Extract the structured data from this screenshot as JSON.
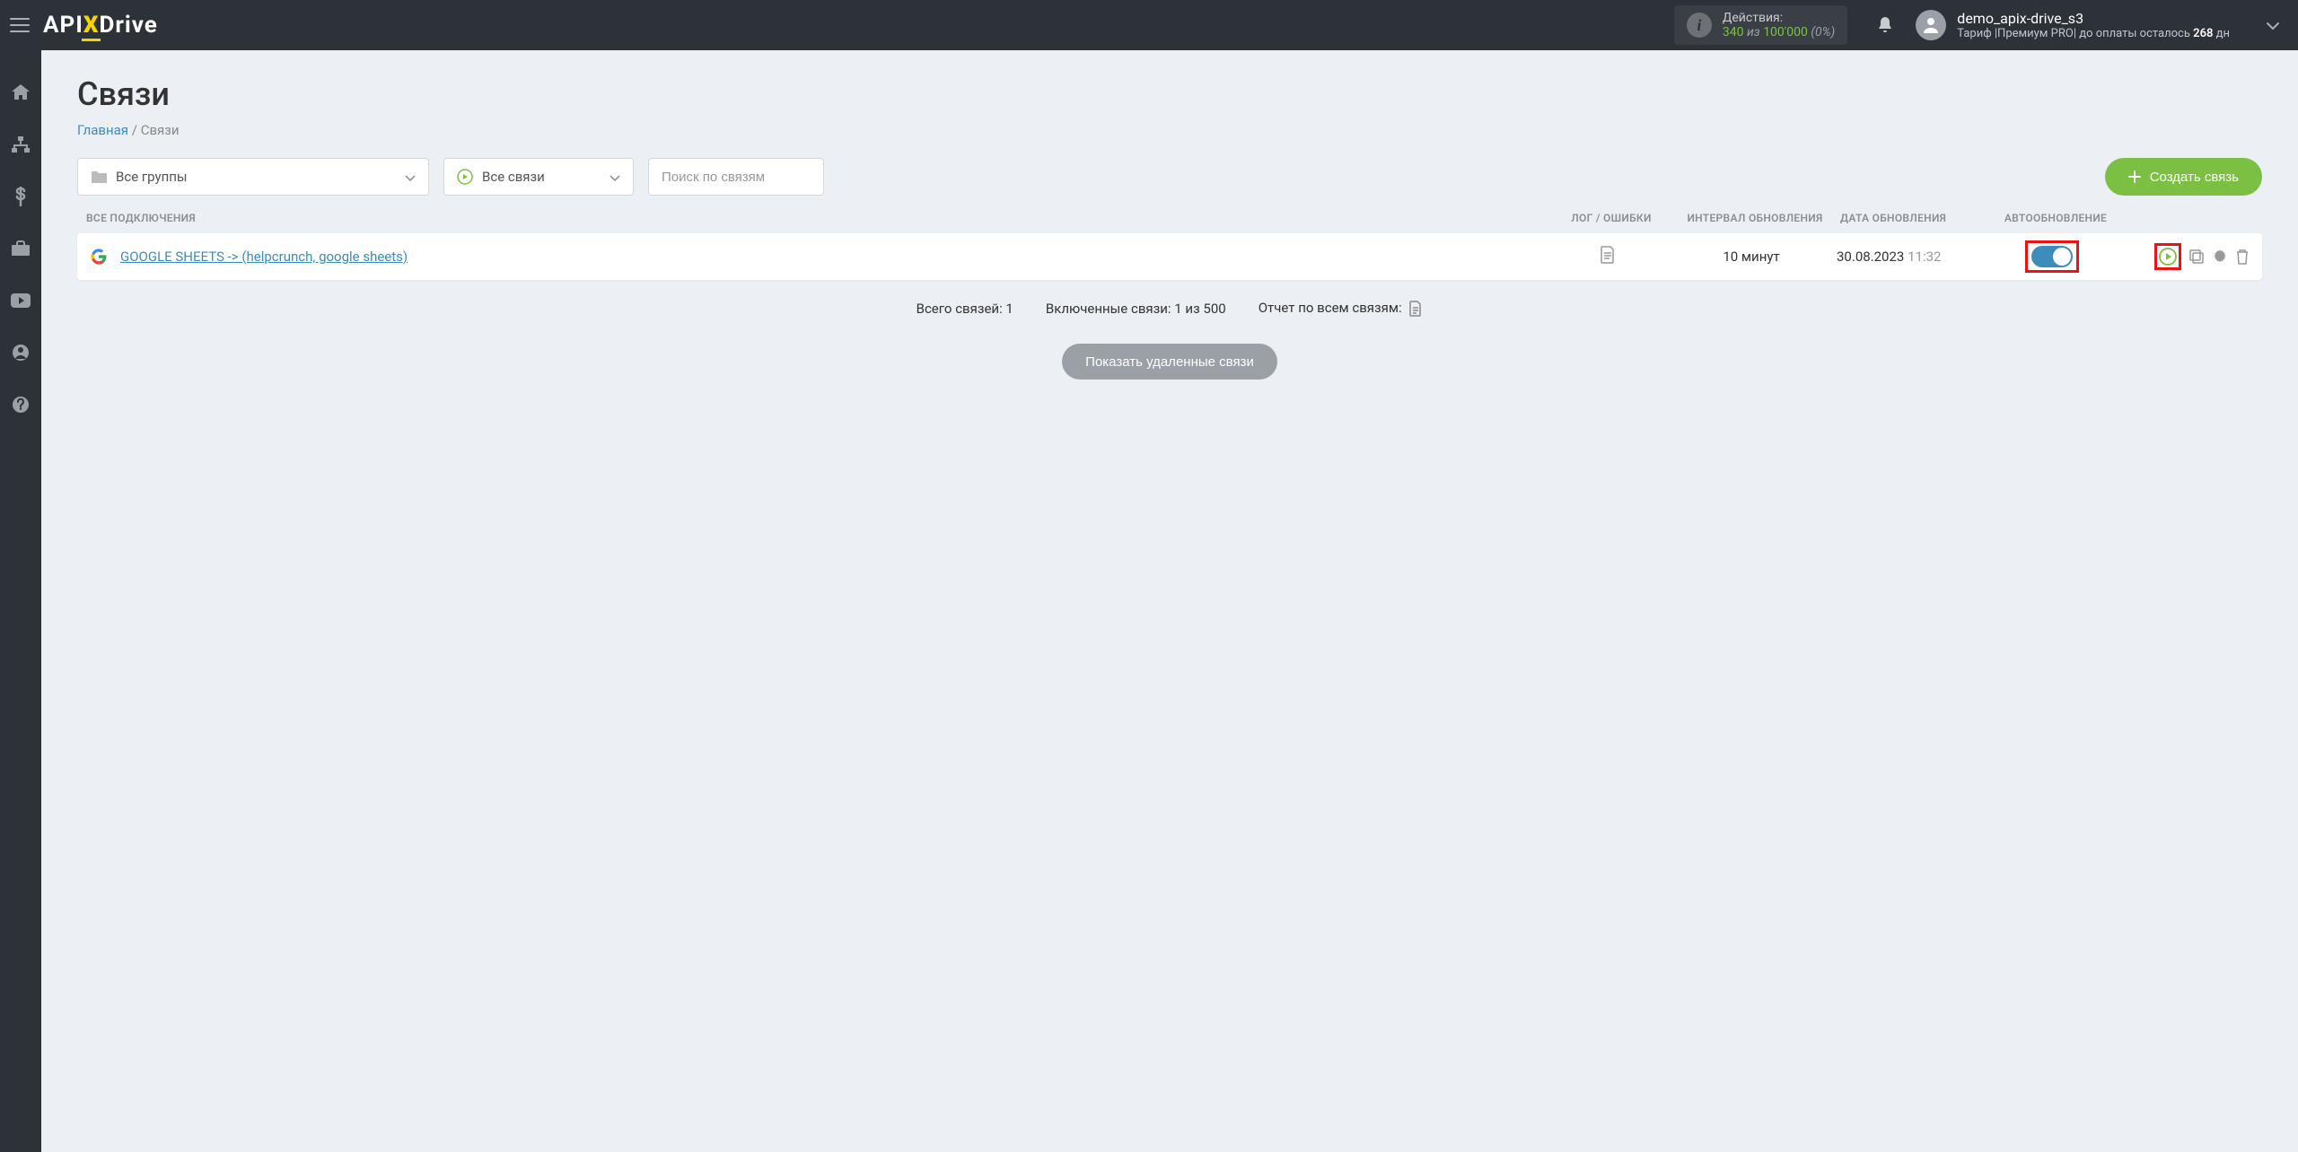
{
  "logo": {
    "part1": "API",
    "part2": "X",
    "part3": "Drive"
  },
  "header": {
    "actions_label": "Действия:",
    "actions_used": "340",
    "actions_of": "из",
    "actions_limit": "100'000",
    "actions_pct": "(0%)",
    "username": "demo_apix-drive_s3",
    "tariff_prefix": "Тариф |Премиум PRO| до оплаты осталось ",
    "tariff_days": "268",
    "tariff_suffix": " дн"
  },
  "page": {
    "title": "Связи",
    "breadcrumb_home": "Главная",
    "breadcrumb_current": "Связи"
  },
  "filters": {
    "groups_label": "Все группы",
    "conns_label": "Все связи",
    "search_placeholder": "Поиск по связям",
    "create_label": "Создать связь"
  },
  "table": {
    "col_name": "ВСЕ ПОДКЛЮЧЕНИЯ",
    "col_log": "ЛОГ / ОШИБКИ",
    "col_interval": "ИНТЕРВАЛ ОБНОВЛЕНИЯ",
    "col_date": "ДАТА ОБНОВЛЕНИЯ",
    "col_auto": "АВТООБНОВЛЕНИЕ"
  },
  "connections": [
    {
      "name": "GOOGLE SHEETS -> (helpcrunch, google sheets)",
      "interval": "10 минут",
      "date": "30.08.2023",
      "time": "11:32"
    }
  ],
  "summary": {
    "total": "Всего связей: 1",
    "enabled": "Включенные связи: 1 из 500",
    "report": "Отчет по всем связям:"
  },
  "show_deleted": "Показать удаленные связи"
}
